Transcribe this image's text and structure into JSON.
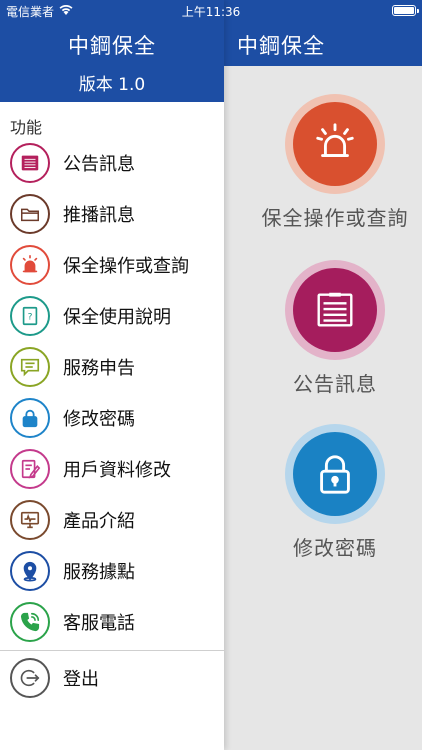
{
  "status_bar": {
    "carrier": "電信業者",
    "time": "上午11:36"
  },
  "drawer": {
    "title": "中鋼保全",
    "version": "版本 1.0",
    "section_label": "功能",
    "items": [
      {
        "label": "公告訊息",
        "icon": "bulletin-board-icon",
        "color": "#b4205c"
      },
      {
        "label": "推播訊息",
        "icon": "folder-icon",
        "color": "#6b3a2a"
      },
      {
        "label": "保全操作或查詢",
        "icon": "alarm-bell-icon",
        "color": "#e14b3b"
      },
      {
        "label": "保全使用說明",
        "icon": "manual-icon",
        "color": "#1d9a8a"
      },
      {
        "label": "服務申告",
        "icon": "chat-icon",
        "color": "#8aa524"
      },
      {
        "label": "修改密碼",
        "icon": "lock-icon",
        "color": "#1e84c9"
      },
      {
        "label": "用戶資料修改",
        "icon": "edit-document-icon",
        "color": "#c43a8c"
      },
      {
        "label": "產品介紹",
        "icon": "monitor-icon",
        "color": "#7a4a2e"
      },
      {
        "label": "服務據點",
        "icon": "map-pin-icon",
        "color": "#1d4ea4"
      },
      {
        "label": "客服電話",
        "icon": "phone-icon",
        "color": "#2ba34a"
      }
    ],
    "logout": {
      "label": "登出",
      "icon": "logout-icon",
      "color": "#555"
    }
  },
  "main": {
    "title": "中鋼保全",
    "tiles": [
      {
        "label": "保全操作或查詢",
        "icon": "alarm-bell-icon",
        "color": "#d9502f",
        "ring": "#f0c2b2"
      },
      {
        "label": "公告訊息",
        "icon": "bulletin-board-icon",
        "color": "#a51d5d",
        "ring": "#e3b3c9"
      },
      {
        "label": "修改密碼",
        "icon": "lock-icon",
        "color": "#1a82c4",
        "ring": "#b6d6ec"
      }
    ]
  }
}
